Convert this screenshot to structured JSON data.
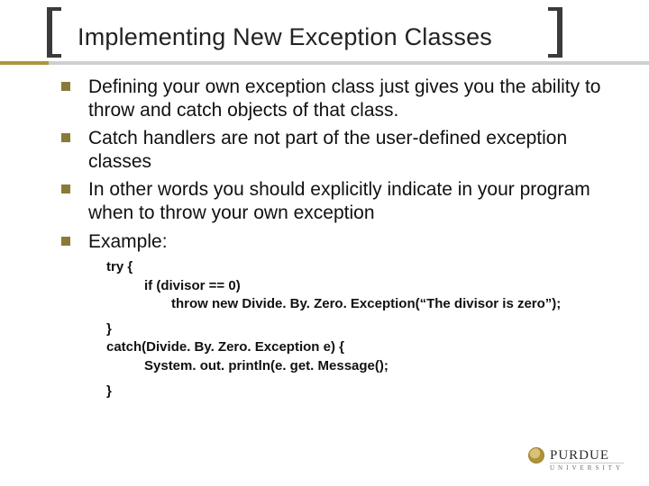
{
  "title": "Implementing New Exception Classes",
  "bullets": [
    "Defining your own exception class just gives you the ability to throw and catch objects of that class.",
    "Catch handlers are not part of the user-defined exception classes",
    "In other words you should explicitly indicate in your program when to throw your own exception",
    "Example:"
  ],
  "code": {
    "l1": "try {",
    "l2": "if (divisor == 0)",
    "l3": "throw new Divide. By. Zero. Exception(“The divisor is zero”);",
    "l4": "}",
    "l5": "catch(Divide. By. Zero. Exception e) {",
    "l6": "System. out. println(e. get. Message();",
    "l7": "}"
  },
  "logo": {
    "name": "PURDUE",
    "sub": "UNIVERSITY"
  }
}
